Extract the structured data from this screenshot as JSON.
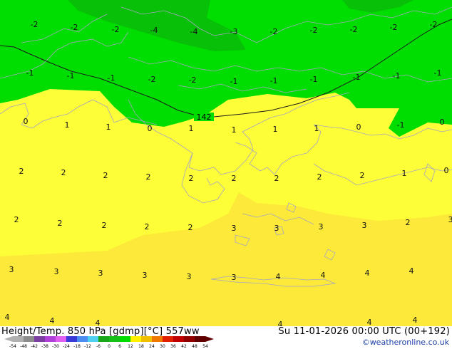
{
  "header": {
    "title": "Height/Temp. 850 hPa [gdmp][°C] 557ww",
    "datetime": "Su 11-01-2026 00:00 UTC (00+192)",
    "credit": "©weatheronline.co.uk"
  },
  "contour_label": "142",
  "temperature_labels": [
    "-2",
    "-2",
    "-2",
    "-4",
    "-4",
    "-3",
    "-2",
    "-2",
    "-2",
    "-2",
    "-2",
    "-1",
    "-1",
    "-1",
    "-2",
    "-2",
    "-1",
    "-1",
    "-1",
    "-1",
    "-1",
    "-1",
    "0",
    "1",
    "1",
    "0",
    "1",
    "1",
    "1",
    "1",
    "0",
    "-1",
    "0",
    "2",
    "2",
    "2",
    "2",
    "2",
    "2",
    "2",
    "2",
    "2",
    "1",
    "0",
    "2",
    "2",
    "2",
    "2",
    "2",
    "3",
    "3",
    "3",
    "3",
    "2",
    "3",
    "3",
    "3",
    "3",
    "3",
    "3",
    "3",
    "4",
    "4",
    "4",
    "4",
    "4",
    "4",
    "4",
    "4",
    "4",
    "4"
  ],
  "legend": {
    "ticks": [
      "-54",
      "-48",
      "-42",
      "-38",
      "-30",
      "-24",
      "-18",
      "-12",
      "-6",
      "0",
      "6",
      "12",
      "18",
      "24",
      "30",
      "36",
      "42",
      "48",
      "54"
    ],
    "colors": [
      "#b0b0b0",
      "#8c8c8c",
      "#7a3fa0",
      "#b040d8",
      "#e05ff0",
      "#3a3ad8",
      "#4a8cf0",
      "#50d0f0",
      "#1aa81a",
      "#16c016",
      "#00dc00",
      "#fff000",
      "#f0c000",
      "#f07800",
      "#e02000",
      "#c00000",
      "#900000",
      "#600000"
    ],
    "zone_colors": {
      "dark_green": "#07c007",
      "green": "#00dd00",
      "yellow": "#fefe38",
      "dark_yellow": "#fce93a"
    }
  }
}
